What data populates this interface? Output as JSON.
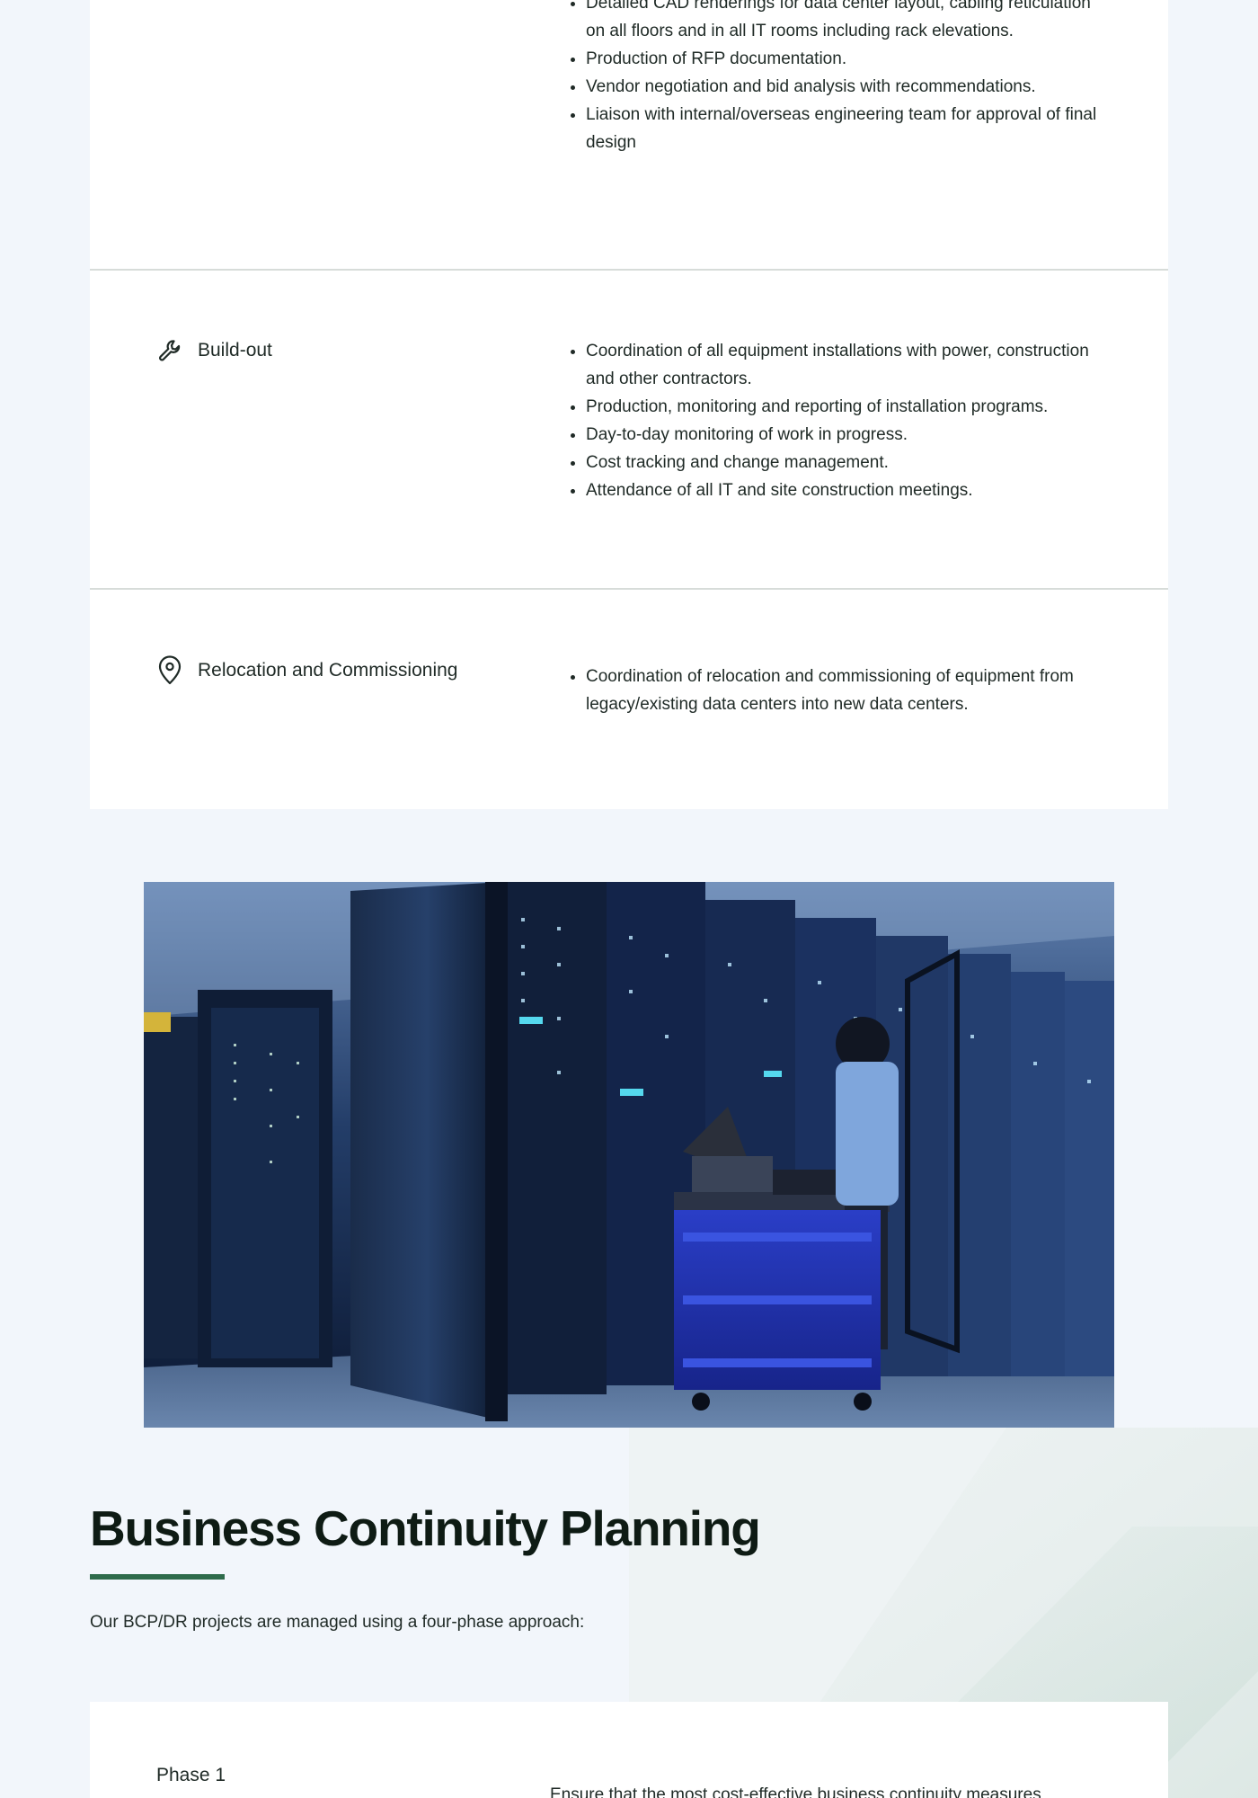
{
  "services": [
    {
      "label": "",
      "icon": "none",
      "bullets": [
        "Detailed CAD renderings for data center layout, cabling reticulation on all floors and in all IT rooms including rack elevations.",
        "Production of RFP documentation.",
        "Vendor negotiation and bid analysis with recommendations.",
        "Liaison with internal/overseas engineering team for approval of final design"
      ]
    },
    {
      "label": "Build-out",
      "icon": "wrench-icon",
      "bullets": [
        "Coordination of all equipment installations with power, construction and other contractors.",
        "Production, monitoring and reporting of installation programs.",
        "Day-to-day monitoring of work in progress.",
        "Cost tracking and change management.",
        "Attendance of all IT and site construction meetings."
      ]
    },
    {
      "label": "Relocation and Commissioning",
      "icon": "location-pin-icon",
      "bullets": [
        "Coordination of relocation and commissioning of equipment from legacy/existing data centers into new data centers."
      ]
    }
  ],
  "hero_image": {
    "subject": "data-center-technician-photo"
  },
  "bcp": {
    "title": "Business Continuity Planning",
    "intro": "Our BCP/DR projects are managed using a four-phase approach:",
    "phase_title": "Phase 1",
    "phase_desc": "Ensure that the most cost-effective business continuity measures"
  },
  "colors": {
    "page_bg": "#f2f6fb",
    "card_bg": "#ffffff",
    "accent_green": "#2e6b4b",
    "divider": "#d7dcd9"
  }
}
